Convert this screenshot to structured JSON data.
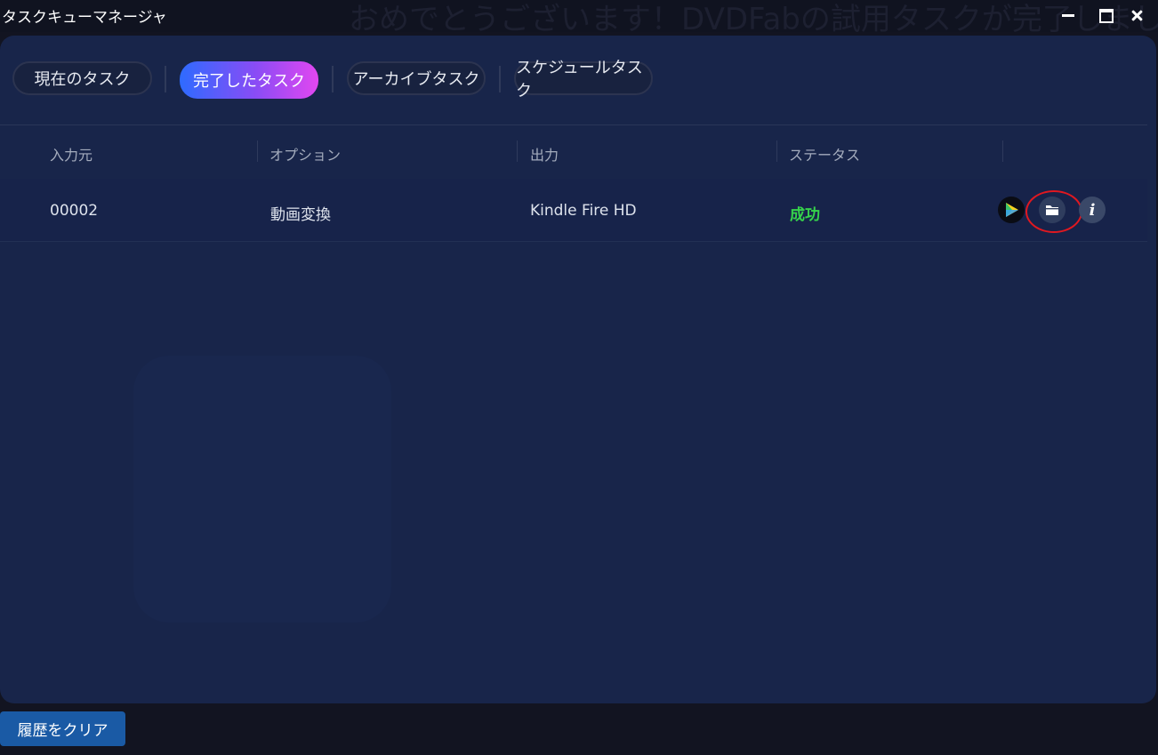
{
  "window": {
    "title": "タスクキューマネージャ",
    "background_banner": "おめでとうございます！DVDFabの試用タスクが完了しました"
  },
  "tabs": [
    {
      "label": "現在のタスク",
      "active": false
    },
    {
      "label": "完了したタスク",
      "active": true
    },
    {
      "label": "アーカイブタスク",
      "active": false
    },
    {
      "label": "スケジュールタスク",
      "active": false
    }
  ],
  "table": {
    "columns": [
      "入力元",
      "オプション",
      "出力",
      "ステータス"
    ],
    "rows": [
      {
        "source": "00002",
        "option": "動画変換",
        "output": "Kindle Fire HD",
        "status": "成功"
      }
    ]
  },
  "row_actions": [
    "play-icon",
    "folder-icon",
    "info-icon"
  ],
  "footer": {
    "clear_label": "履歴をクリア"
  },
  "colors": {
    "status_success": "#36d34b",
    "accent_gradient_start": "#2e6bff",
    "accent_gradient_end": "#e247f0",
    "highlight_ring": "#e01820",
    "clear_button": "#1a5aa5"
  }
}
